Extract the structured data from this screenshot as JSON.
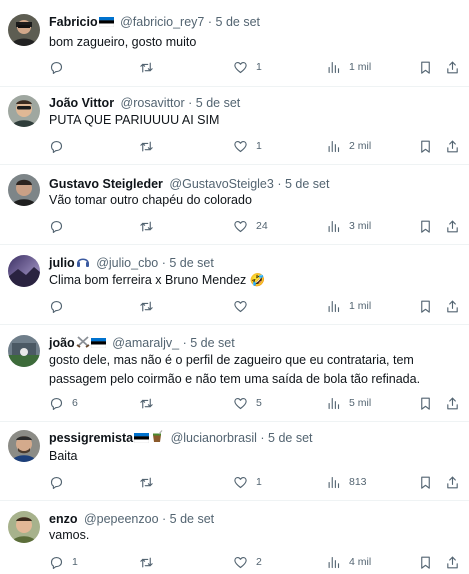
{
  "tweets": [
    {
      "name": "Fabricio",
      "handle": "@fabricio_rey7",
      "dot": "·",
      "date": "5 de set",
      "text": "bom zagueiro, gosto muito",
      "replies": "",
      "retweets": "",
      "likes": "1",
      "views": "1 mil",
      "badges": [
        "flag-estonia-icon"
      ]
    },
    {
      "name": "João Vittor",
      "handle": "@rosavittor",
      "dot": "·",
      "date": "5 de set",
      "text": "PUTA QUE PARIUUUU AI SIM",
      "replies": "",
      "retweets": "",
      "likes": "1",
      "views": "2 mil",
      "badges": []
    },
    {
      "name": "Gustavo Steigleder",
      "handle": "@GustavoSteigle3",
      "dot": "·",
      "date": "5 de set",
      "text": "Vão tomar outro chapéu do colorado",
      "replies": "",
      "retweets": "",
      "likes": "24",
      "views": "3 mil",
      "badges": []
    },
    {
      "name": "julio",
      "handle": "@julio_cbo",
      "dot": "·",
      "date": "5 de set",
      "text": "Clima bom ferreira x Bruno Mendez 🤣",
      "replies": "",
      "retweets": "",
      "likes": "",
      "views": "1 mil",
      "badges": [
        "headphones-emoji-icon"
      ]
    },
    {
      "name": "joão",
      "handle": "@amaraljv_",
      "dot": "·",
      "date": "5 de set",
      "text": "gosto dele, mas não é o perfil de zagueiro que eu contrataria, tem passagem pelo coirmão e não tem uma saída de bola tão refinada.",
      "replies": "6",
      "retweets": "",
      "likes": "5",
      "views": "5 mil",
      "badges": [
        "crossed-swords-emoji-icon",
        "flag-estonia-icon"
      ]
    },
    {
      "name": "pessigremista",
      "handle": "@lucianorbrasil",
      "dot": "·",
      "date": "5 de set",
      "text": "Baita",
      "replies": "",
      "retweets": "",
      "likes": "1",
      "views": "813",
      "badges": [
        "flag-estonia-icon",
        "mate-emoji-icon"
      ]
    },
    {
      "name": "enzo",
      "handle": "@pepeenzoo",
      "dot": "·",
      "date": "5 de set",
      "text": "vamos.",
      "replies": "1",
      "retweets": "",
      "likes": "2",
      "views": "4 mil",
      "badges": []
    }
  ],
  "icons": {
    "reply": "reply-bubble-icon",
    "retweet": "retweet-icon",
    "like": "heart-icon",
    "views": "views-bar-chart-icon",
    "bookmark": "bookmark-icon",
    "share": "share-icon"
  },
  "colors": {
    "text_primary": "#0f1419",
    "text_secondary": "#536471",
    "divider": "#eff3f4",
    "background": "#ffffff"
  }
}
